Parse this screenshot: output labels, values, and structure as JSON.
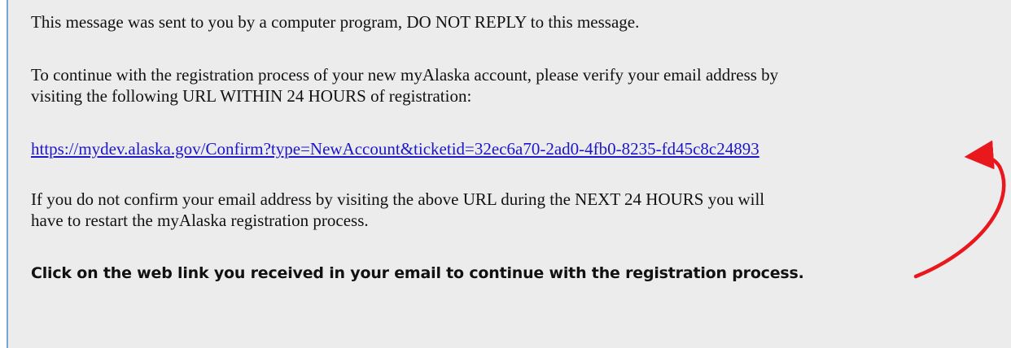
{
  "email": {
    "warning": "This message was sent to you by a computer program, DO NOT REPLY to this message.",
    "instructions_line1": "To continue with the registration process of your new myAlaska account, please verify your email address by",
    "instructions_line2": "visiting the following URL WITHIN 24 HOURS of registration:",
    "confirm_url": "https://mydev.alaska.gov/Confirm?type=NewAccount&ticketid=32ec6a70-2ad0-4fb0-8235-fd45c8c24893",
    "expiry_line1": "If you do not confirm your email address by visiting the above URL during the NEXT 24 HOURS you will",
    "expiry_line2": "have to restart the myAlaska registration process."
  },
  "callout": {
    "text": "Click on the web link you received in your email to continue with the registration process.",
    "arrow_color": "#e8181d"
  },
  "colors": {
    "background": "#ececec",
    "link": "#1d16c8",
    "left_border": "#7aa3d8"
  }
}
